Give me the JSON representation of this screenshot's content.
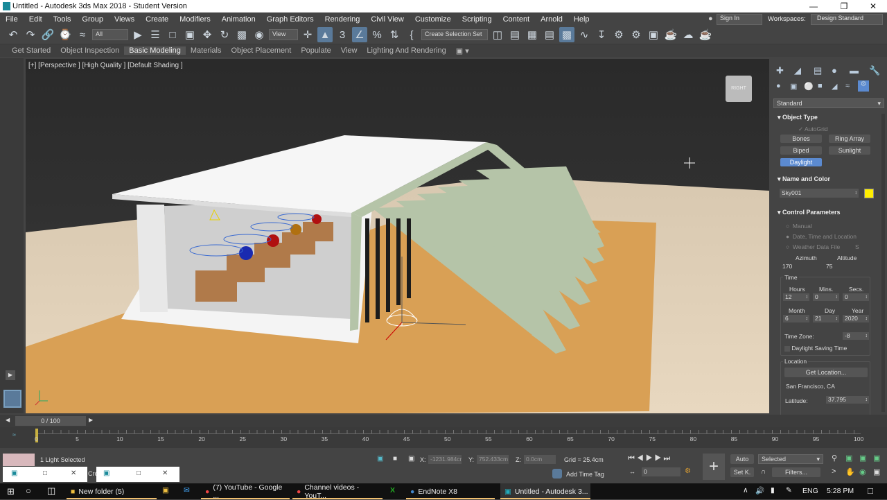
{
  "window": {
    "title": "Untitled - Autodesk 3ds Max 2018 - Student Version",
    "minimize": "—",
    "restore": "❐",
    "close": "✕"
  },
  "menu": [
    "File",
    "Edit",
    "Tools",
    "Group",
    "Views",
    "Create",
    "Modifiers",
    "Animation",
    "Graph Editors",
    "Rendering",
    "Civil View",
    "Customize",
    "Scripting",
    "Content",
    "Arnold",
    "Help"
  ],
  "account": {
    "sign_in": "Sign In",
    "workspaces_label": "Workspaces:",
    "workspace": "Design Standard"
  },
  "toolbar": {
    "selection_filter": "All",
    "ref_coord": "View",
    "named_selection": "Create Selection Set"
  },
  "ribbon": {
    "tabs": [
      "Get Started",
      "Object Inspection",
      "Basic Modeling",
      "Materials",
      "Object Placement",
      "Populate",
      "View",
      "Lighting And Rendering"
    ],
    "active": "Basic Modeling"
  },
  "viewport": {
    "label": "[+] [Perspective ] [High Quality ] [Default Shading ]",
    "viewcube": "RIGHT"
  },
  "panel": {
    "category": "Standard",
    "object_type": {
      "title": "Object Type",
      "autogrid": "AutoGrid",
      "buttons": [
        "Bones",
        "Ring Array",
        "Biped",
        "Sunlight",
        "Daylight"
      ],
      "selected": "Daylight"
    },
    "name_color": {
      "title": "Name and Color",
      "name": "Sky001",
      "color": "#ffee00"
    },
    "control": {
      "title": "Control Parameters",
      "options": [
        "Manual",
        "Date, Time and Location",
        "Weather Data File"
      ],
      "selected": "Date, Time and Location",
      "s_button": "S",
      "azimuth_label": "Azimuth",
      "altitude_label": "Altitude",
      "azimuth": "170",
      "altitude": "75",
      "time": {
        "title": "Time",
        "hours_label": "Hours",
        "mins_label": "Mins.",
        "secs_label": "Secs.",
        "hours": "12",
        "mins": "0",
        "secs": "0",
        "month_label": "Month",
        "day_label": "Day",
        "year_label": "Year",
        "month": "6",
        "day": "21",
        "year": "2020",
        "tz_label": "Time Zone:",
        "tz": "-8",
        "dst": "Daylight Saving Time"
      },
      "location": {
        "title": "Location",
        "get": "Get Location...",
        "city": "San Francisco, CA",
        "lat_label": "Latitude:",
        "lat": "37.795"
      }
    }
  },
  "timeline": {
    "frame": "0 / 100",
    "ticks": [
      "0",
      "5",
      "10",
      "15",
      "20",
      "25",
      "30",
      "35",
      "40",
      "45",
      "50",
      "55",
      "60",
      "65",
      "70",
      "75",
      "80",
      "85",
      "90",
      "95",
      "100"
    ]
  },
  "status": {
    "selected": "1 Light Selected",
    "x_label": "X:",
    "x": "-1231.984cr",
    "y_label": "Y:",
    "y": "752.433cm",
    "z_label": "Z:",
    "z": "0.0cm",
    "grid": "Grid = 25.4cm",
    "add_time_tag": "Add Time Tag",
    "frame": "0",
    "auto": "Auto",
    "setkey": "Set K.",
    "key_mode": "Selected",
    "filters": "Filters...",
    "cre": "Cre"
  },
  "taskbar": {
    "items": [
      "New folder (5)",
      "(7) YouTube - Google ...",
      "Channel videos - YouT...",
      "EndNote X8",
      "Untitled - Autodesk 3..."
    ],
    "lang": "ENG",
    "time": "5:28 PM"
  }
}
